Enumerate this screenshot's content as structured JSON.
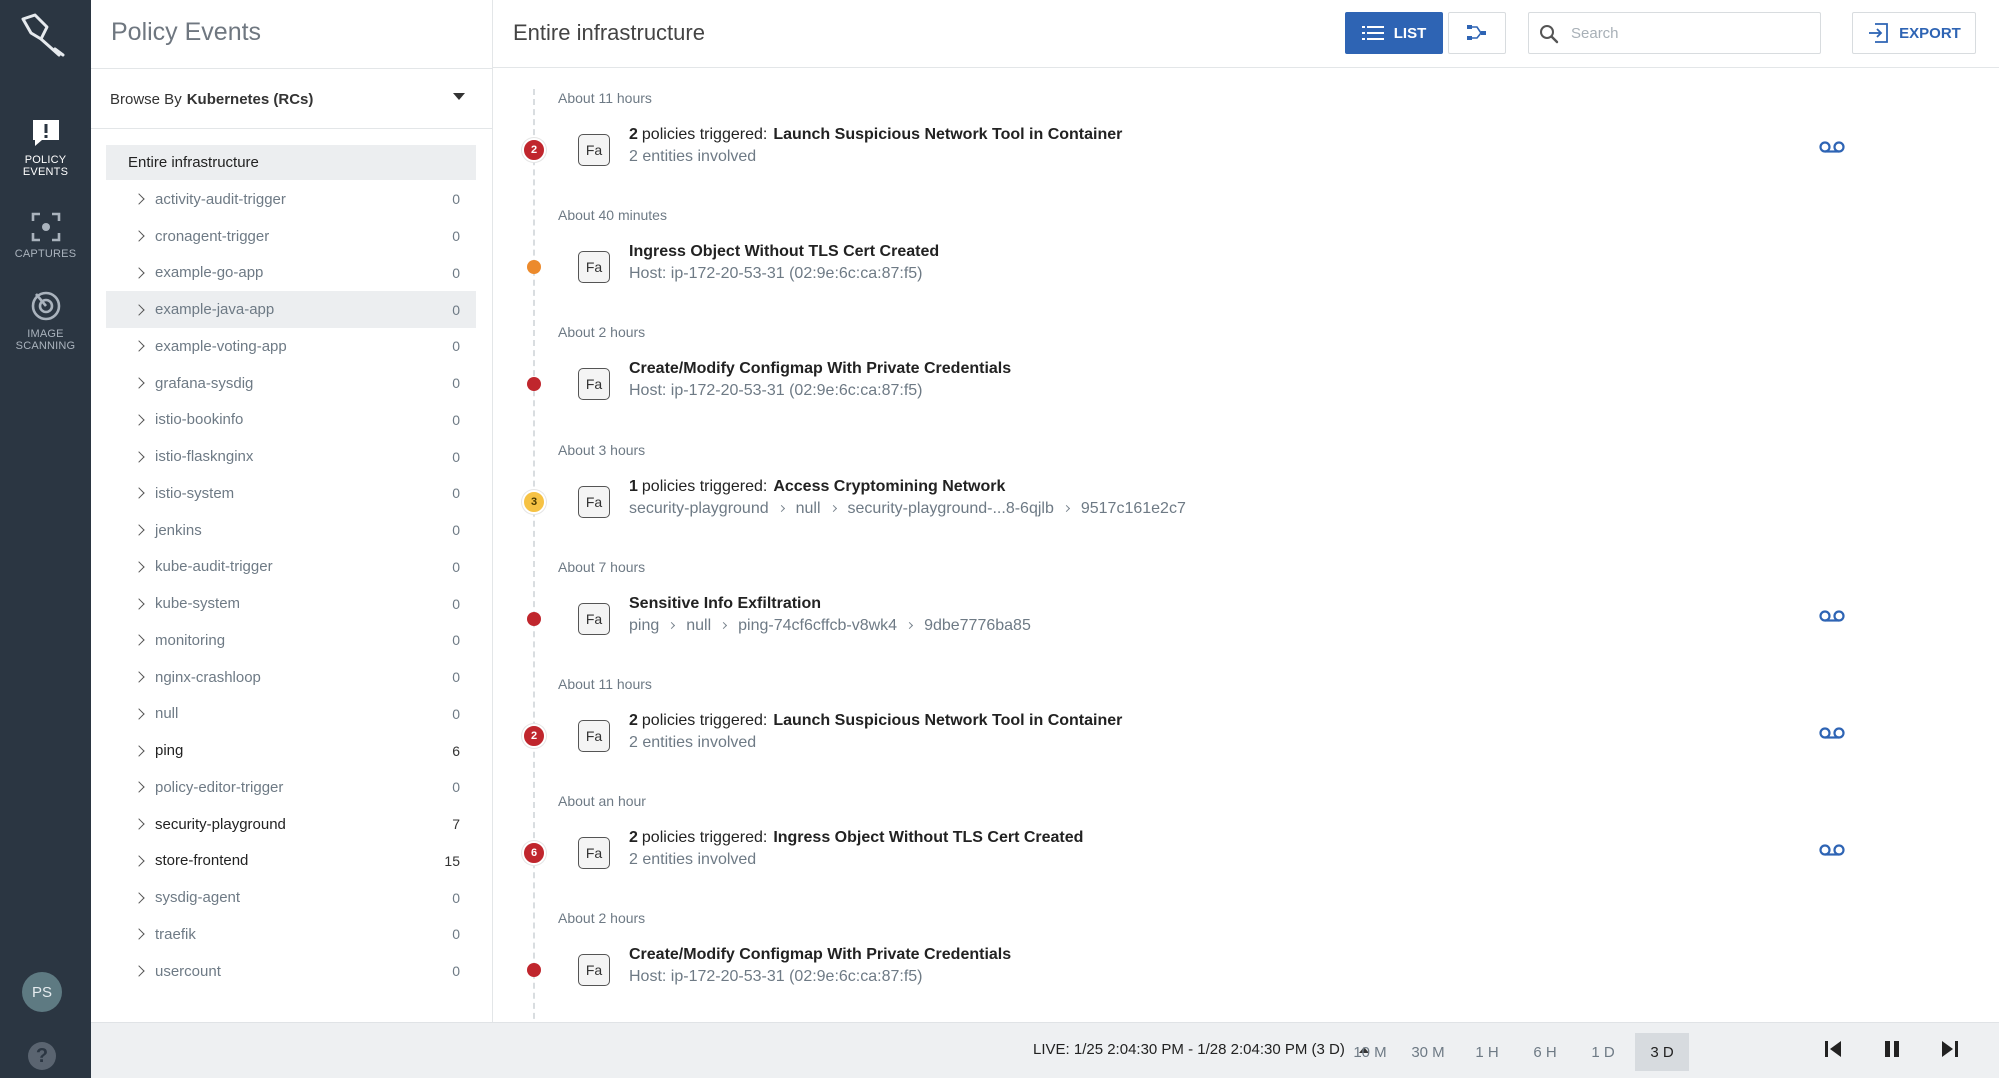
{
  "sidebar": {
    "nav": [
      {
        "label_line1": "POLICY",
        "label_line2": "EVENTS",
        "icon": "alert-speech-icon"
      },
      {
        "label_line1": "CAPTURES",
        "label_line2": "",
        "icon": "capture-frame-icon"
      },
      {
        "label_line1": "IMAGE",
        "label_line2": "SCANNING",
        "icon": "scan-target-icon"
      }
    ],
    "avatar": "PS",
    "help": "?"
  },
  "panel": {
    "title": "Policy Events",
    "browse_prefix": "Browse By",
    "browse_value": "Kubernetes (RCs)",
    "root": "Entire infrastructure",
    "items": [
      {
        "name": "activity-audit-trigger",
        "count": "0"
      },
      {
        "name": "cronagent-trigger",
        "count": "0"
      },
      {
        "name": "example-go-app",
        "count": "0"
      },
      {
        "name": "example-java-app",
        "count": "0"
      },
      {
        "name": "example-voting-app",
        "count": "0"
      },
      {
        "name": "grafana-sysdig",
        "count": "0"
      },
      {
        "name": "istio-bookinfo",
        "count": "0"
      },
      {
        "name": "istio-flasknginx",
        "count": "0"
      },
      {
        "name": "istio-system",
        "count": "0"
      },
      {
        "name": "jenkins",
        "count": "0"
      },
      {
        "name": "kube-audit-trigger",
        "count": "0"
      },
      {
        "name": "kube-system",
        "count": "0"
      },
      {
        "name": "monitoring",
        "count": "0"
      },
      {
        "name": "nginx-crashloop",
        "count": "0"
      },
      {
        "name": "null",
        "count": "0"
      },
      {
        "name": "ping",
        "count": "6"
      },
      {
        "name": "policy-editor-trigger",
        "count": "0"
      },
      {
        "name": "security-playground",
        "count": "7"
      },
      {
        "name": "store-frontend",
        "count": "15"
      },
      {
        "name": "sysdig-agent",
        "count": "0"
      },
      {
        "name": "traefik",
        "count": "0"
      },
      {
        "name": "usercount",
        "count": "0"
      }
    ]
  },
  "main": {
    "title": "Entire infrastructure",
    "list_label": "LIST",
    "search_placeholder": "Search",
    "export_label": "EXPORT",
    "events": [
      {
        "time": "About 11 hours",
        "badge": "2",
        "severity_color": "#c0262d",
        "icon_text": "Fa",
        "count": "2",
        "head_text": "policies triggered:",
        "policy": "Launch Suspicious Network Tool in Container",
        "sub": "2 entities involved",
        "has_capture": true
      },
      {
        "time": "About 40 minutes",
        "badge": "",
        "severity_color": "#ec8a2c",
        "icon_text": "Fa",
        "title": "Ingress Object Without TLS Cert Created",
        "sub": "Host: ip-172-20-53-31 (02:9e:6c:ca:87:f5)",
        "has_capture": false
      },
      {
        "time": "About 2 hours",
        "badge": "",
        "severity_color": "#c0262d",
        "icon_text": "Fa",
        "title": "Create/Modify Configmap With Private Credentials",
        "sub": "Host: ip-172-20-53-31 (02:9e:6c:ca:87:f5)",
        "has_capture": false
      },
      {
        "time": "About 3 hours",
        "badge": "3",
        "severity_color": "#f6c244",
        "icon_text": "Fa",
        "count": "1",
        "head_text": "policies triggered:",
        "policy": "Access Cryptomining Network",
        "path": [
          "security-playground",
          "null",
          "security-playground-...8-6qjlb",
          "9517c161e2c7"
        ],
        "has_capture": false
      },
      {
        "time": "About 7 hours",
        "badge": "",
        "severity_color": "#c0262d",
        "icon_text": "Fa",
        "title": "Sensitive Info Exfiltration",
        "path": [
          "ping",
          "null",
          "ping-74cf6cffcb-v8wk4",
          "9dbe7776ba85"
        ],
        "has_capture": true
      },
      {
        "time": "About 11 hours",
        "badge": "2",
        "severity_color": "#c0262d",
        "icon_text": "Fa",
        "count": "2",
        "head_text": "policies triggered:",
        "policy": "Launch Suspicious Network Tool in Container",
        "sub": "2 entities involved",
        "has_capture": true
      },
      {
        "time": "About an hour",
        "badge": "6",
        "severity_color": "#c0262d",
        "icon_text": "Fa",
        "count": "2",
        "head_text": "policies triggered:",
        "policy": "Ingress Object Without TLS Cert Created",
        "sub": "2 entities involved",
        "has_capture": true
      },
      {
        "time": "About 2 hours",
        "badge": "",
        "severity_color": "#c0262d",
        "icon_text": "Fa",
        "title": "Create/Modify Configmap With Private Credentials",
        "sub": "Host: ip-172-20-53-31 (02:9e:6c:ca:87:f5)",
        "has_capture": false
      }
    ]
  },
  "bottombar": {
    "live": "LIVE: 1/25 2:04:30 PM - 1/28 2:04:30 PM (3 D)",
    "ranges": [
      "10 M",
      "30 M",
      "1 H",
      "6 H",
      "1 D",
      "3 D"
    ],
    "active_range": "3 D"
  },
  "colors": {
    "accent": "#2e64b4",
    "rail": "#2b3642",
    "severity_high": "#c0262d",
    "severity_medium": "#ec8a2c",
    "severity_low": "#f6c244"
  }
}
